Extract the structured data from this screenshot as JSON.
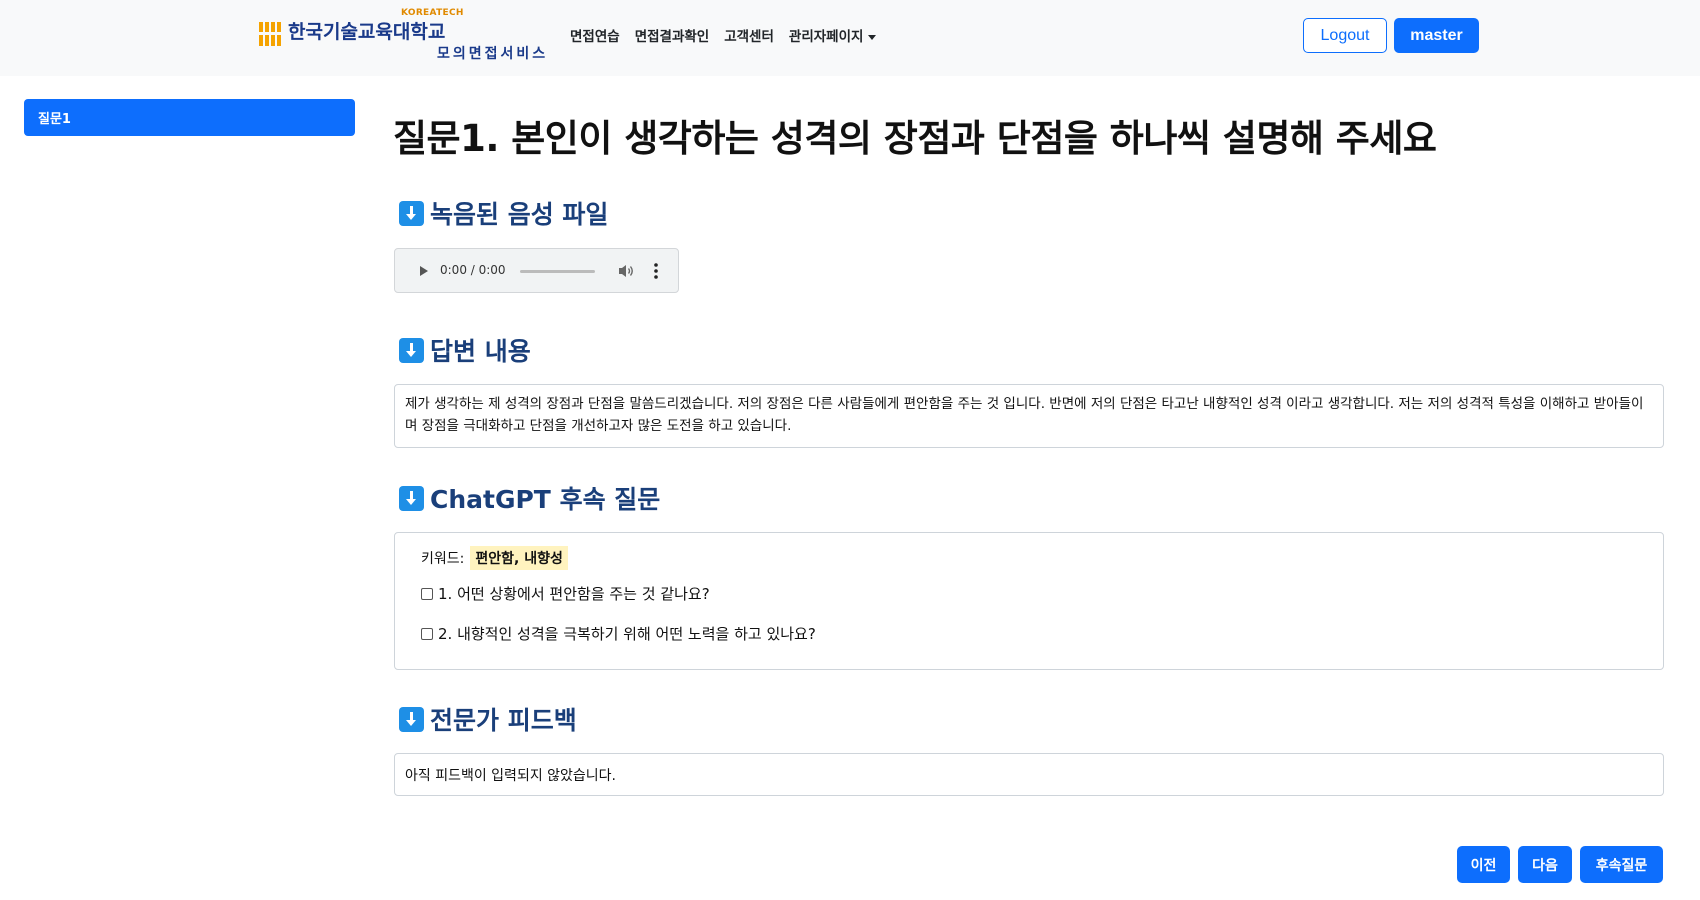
{
  "brand": {
    "tech_label": "KOREATECH",
    "name": "한국기술교육대학교",
    "subtitle": "모의면접서비스"
  },
  "nav": {
    "items": [
      {
        "label": "면접연습"
      },
      {
        "label": "면접결과확인"
      },
      {
        "label": "고객센터"
      },
      {
        "label": "관리자페이지"
      }
    ],
    "logout_label": "Logout",
    "user_label": "master"
  },
  "sidebar": {
    "items": [
      {
        "label": "질문1",
        "active": true
      }
    ]
  },
  "main": {
    "title": "질문1. 본인이 생각하는 성격의 장점과 단점을 하나씩 설명해 주세요",
    "sections": {
      "audio_title": "녹음된 음성 파일",
      "answer_title": "답변 내용",
      "followup_title": "ChatGPT 후속 질문",
      "feedback_title": "전문가 피드백"
    },
    "audio": {
      "time": "0:00 / 0:00"
    },
    "answer_text": "제가 생각하는 제 성격의 장점과 단점을 말씀드리겠습니다. 저의 장점은 다른 사람들에게 편안함을 주는 것 입니다. 반면에 저의 단점은 타고난 내향적인 성격 이라고 생각합니다. 저는 저의 성격적 특성을 이해하고 받아들이며 장점을 극대화하고 단점을 개선하고자 많은 도전을 하고 있습니다.",
    "followup": {
      "keyword_label": "키워드:",
      "keywords": "편안함, 내향성",
      "questions": [
        {
          "text": "1. 어떤 상황에서 편안함을 주는 것 같나요?",
          "checked": false
        },
        {
          "text": "2. 내향적인 성격을 극복하기 위해 어떤 노력을 하고 있나요?",
          "checked": false
        }
      ]
    },
    "feedback_text": "아직 피드백이 입력되지 않았습니다."
  },
  "buttons": {
    "prev": "이전",
    "next": "다음",
    "followup": "후속질문"
  },
  "colors": {
    "primary": "#0d6efd",
    "section_heading": "#1a3f7a",
    "section_icon": "#1e8fe6",
    "keyword_highlight": "#fff3bf"
  }
}
